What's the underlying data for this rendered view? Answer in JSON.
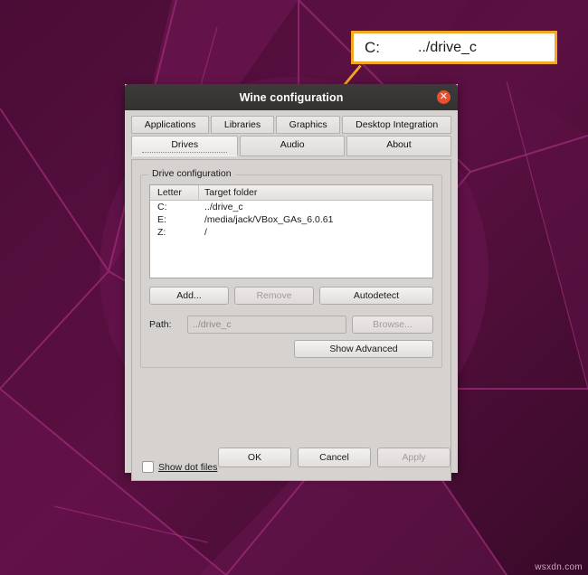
{
  "callout": {
    "letter": "C:",
    "path": "../drive_c"
  },
  "window": {
    "title": "Wine configuration",
    "close_icon": "close-icon",
    "tabs_row1": [
      {
        "label": "Applications",
        "selected": false
      },
      {
        "label": "Libraries",
        "selected": false
      },
      {
        "label": "Graphics",
        "selected": false
      },
      {
        "label": "Desktop Integration",
        "selected": false
      }
    ],
    "tabs_row2": [
      {
        "label": "Drives",
        "selected": true
      },
      {
        "label": "Audio",
        "selected": false
      },
      {
        "label": "About",
        "selected": false
      }
    ],
    "drive_group": {
      "legend": "Drive configuration",
      "columns": [
        "Letter",
        "Target folder"
      ],
      "rows": [
        {
          "letter": "C:",
          "target": "../drive_c"
        },
        {
          "letter": "E:",
          "target": "/media/jack/VBox_GAs_6.0.61"
        },
        {
          "letter": "Z:",
          "target": "/"
        }
      ],
      "buttons": {
        "add": "Add...",
        "remove": "Remove",
        "autodetect": "Autodetect"
      },
      "path_label": "Path:",
      "path_value": "../drive_c",
      "browse": "Browse...",
      "show_advanced": "Show Advanced"
    },
    "show_dot_files": "Show dot files",
    "footer": {
      "ok": "OK",
      "cancel": "Cancel",
      "apply": "Apply"
    }
  },
  "watermark": "wsxdn.com",
  "colors": {
    "accent": "#f5a623",
    "close": "#e8502c",
    "titlebar": "#373634",
    "window_bg": "#d6d2d0"
  }
}
